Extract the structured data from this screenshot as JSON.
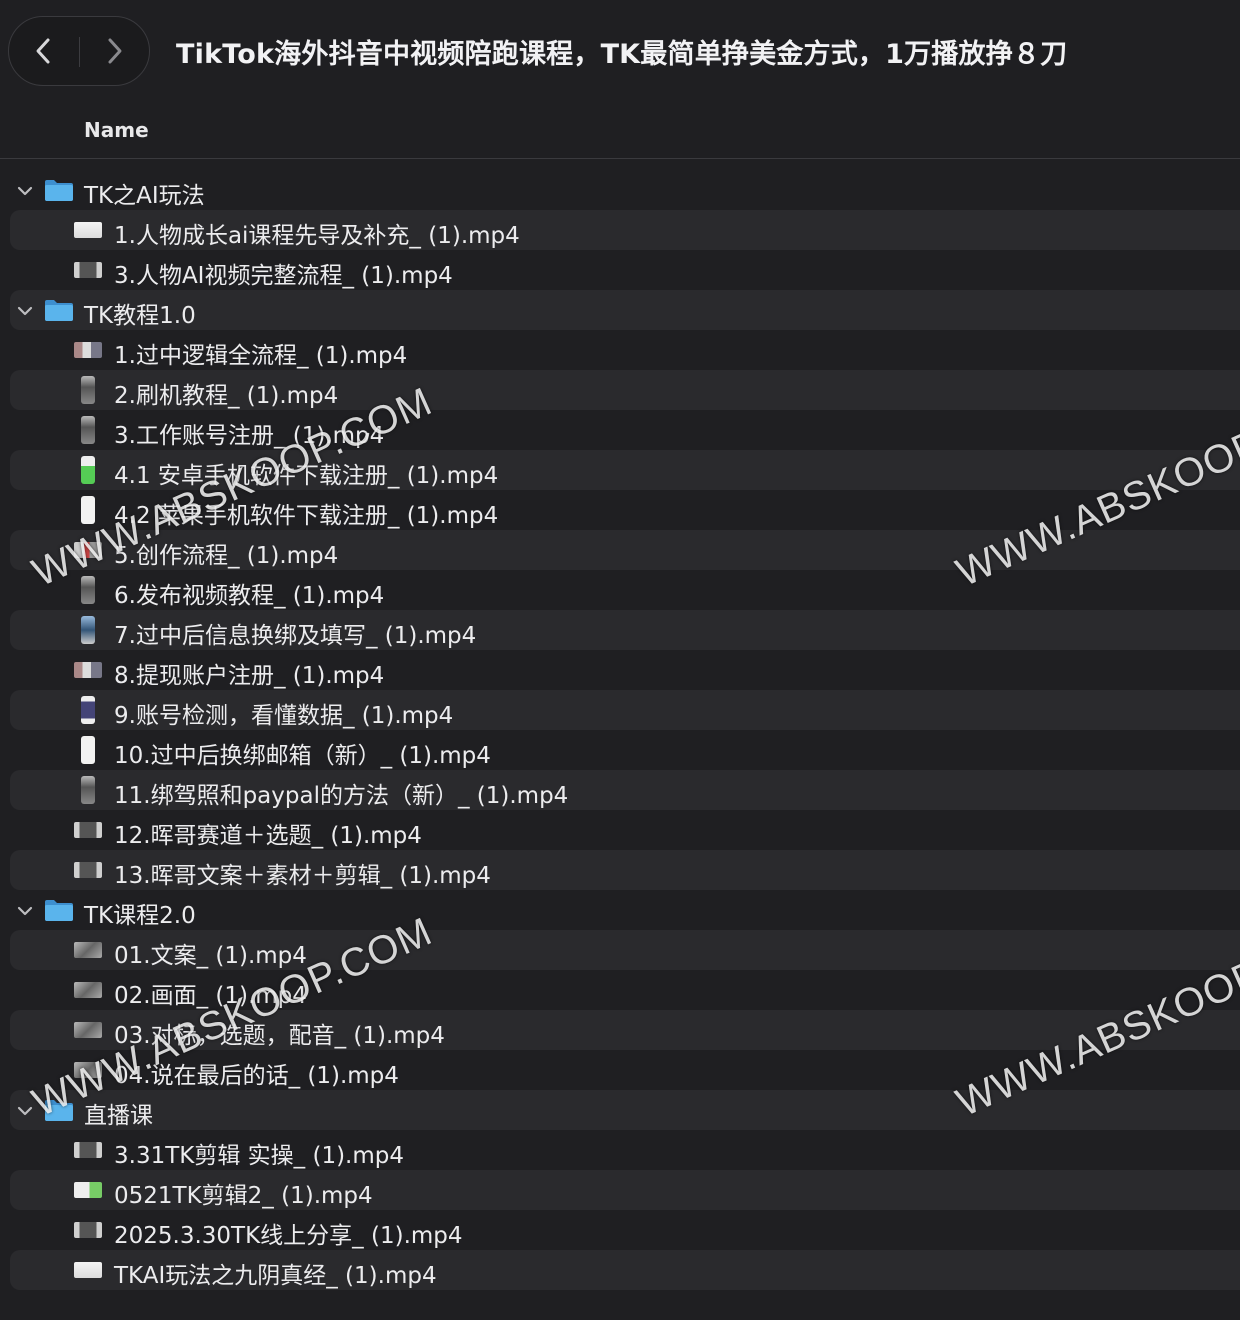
{
  "window": {
    "title": "TikTok海外抖音中视频陪跑课程，TK最简单挣美金方式，1万播放挣８刀",
    "back_icon": "chevron-left-icon",
    "forward_icon": "chevron-right-icon"
  },
  "table": {
    "column_name": "Name"
  },
  "colors": {
    "background": "#1f1f22",
    "row_stripe": "#2a2a2d",
    "folder_blue": "#5ab4ec"
  },
  "folders": [
    {
      "name": "TK之AI玩法",
      "files": [
        {
          "name": "1.人物成长ai课程先导及补充_ (1).mp4",
          "thumb": "landscape-light"
        },
        {
          "name": "3.人物AI视频完整流程_ (1).mp4",
          "thumb": "landscape-dark"
        }
      ]
    },
    {
      "name": "TK教程1.0",
      "files": [
        {
          "name": "1.过中逻辑全流程_ (1).mp4",
          "thumb": "landscape-mixed"
        },
        {
          "name": "2.刷机教程_ (1).mp4",
          "thumb": "portrait-phone"
        },
        {
          "name": "3.工作账号注册_ (1).mp4",
          "thumb": "portrait-phone"
        },
        {
          "name": "4.1 安卓手机软件下载注册_ (1).mp4",
          "thumb": "portrait-green"
        },
        {
          "name": "4.2 苹果手机软件下载注册_ (1).mp4",
          "thumb": "portrait-white"
        },
        {
          "name": "5.创作流程_ (1).mp4",
          "thumb": "landscape-red"
        },
        {
          "name": "6.发布视频教程_ (1).mp4",
          "thumb": "portrait-phone"
        },
        {
          "name": "7.过中后信息换绑及填写_ (1).mp4",
          "thumb": "portrait-blue"
        },
        {
          "name": "8.提现账户注册_ (1).mp4",
          "thumb": "landscape-mixed"
        },
        {
          "name": "9.账号检测，看懂数据_ (1).mp4",
          "thumb": "portrait-dark"
        },
        {
          "name": "10.过中后换绑邮箱（新）_ (1).mp4",
          "thumb": "portrait-white"
        },
        {
          "name": "11.绑驾照和paypal的方法（新）_ (1).mp4",
          "thumb": "portrait-phone"
        },
        {
          "name": "12.晖哥赛道＋选题_ (1).mp4",
          "thumb": "landscape-dark"
        },
        {
          "name": "13.晖哥文案＋素材＋剪辑_ (1).mp4",
          "thumb": "landscape-dark"
        }
      ]
    },
    {
      "name": "TK课程2.0",
      "files": [
        {
          "name": "01.文案_ (1).mp4",
          "thumb": "landscape-gray"
        },
        {
          "name": "02.画面_ (1).mp4",
          "thumb": "landscape-gray"
        },
        {
          "name": "03.对标，选题，配音_ (1).mp4",
          "thumb": "landscape-gray"
        },
        {
          "name": "04.说在最后的话_ (1).mp4",
          "thumb": "landscape-gray"
        }
      ]
    },
    {
      "name": "直播课",
      "files": [
        {
          "name": "3.31TK剪辑 实操_ (1).mp4",
          "thumb": "landscape-dark"
        },
        {
          "name": "0521TK剪辑2_ (1).mp4",
          "thumb": "landscape-green"
        },
        {
          "name": "2025.3.30TK线上分享_ (1).mp4",
          "thumb": "landscape-dark"
        },
        {
          "name": "TKAI玩法之九阴真经_ (1).mp4",
          "thumb": "landscape-light"
        }
      ]
    }
  ],
  "watermarks": [
    "WWW.ABSKOOP.COM",
    "WWW.ABSKOOP.COM",
    "WWW.ABSKOOP.COM",
    "WWW.ABSKOOP.COM"
  ]
}
